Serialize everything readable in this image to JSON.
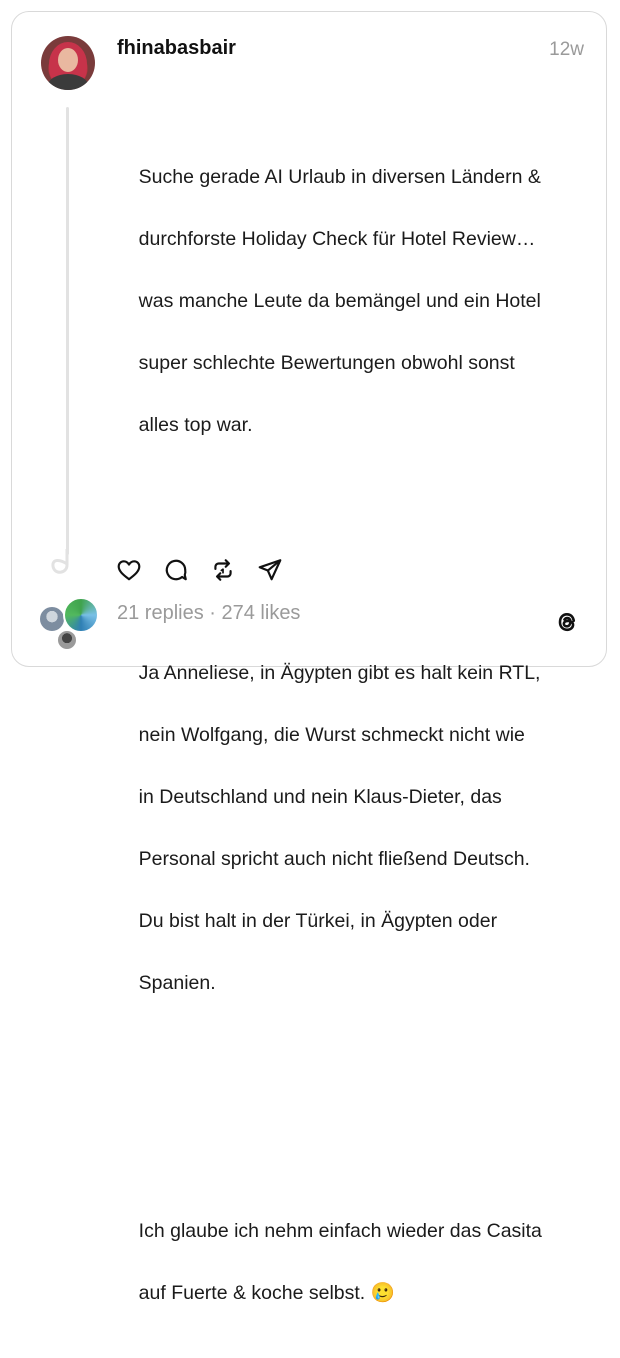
{
  "post": {
    "username": "fhinabasbair",
    "time": "12w",
    "paragraphs": [
      [
        "Suche gerade AI Urlaub in diversen Ländern &",
        "durchforste Holiday Check für Hotel Review…",
        "was manche Leute da bemängel und ein Hotel",
        "super schlechte Bewertungen obwohl sonst",
        "alles top war."
      ],
      [
        "Ja Anneliese, in Ägypten gibt es halt kein RTL,",
        "nein Wolfgang, die Wurst schmeckt nicht wie",
        "in Deutschland und nein Klaus-Dieter, das",
        "Personal spricht auch nicht fließend Deutsch.",
        "Du bist halt in der Türkei, in Ägypten oder",
        "Spanien."
      ],
      [
        "Ich glaube ich nehm einfach wieder das Casita",
        "auf Fuerte & koche selbst. 🥲"
      ]
    ]
  },
  "stats": {
    "replies": "21 replies",
    "separator": " · ",
    "likes": "274 likes"
  },
  "icons": {
    "like": "heart-icon",
    "comment": "comment-icon",
    "repost": "repost-icon",
    "share": "share-icon",
    "brand": "threads-logo-icon"
  },
  "colors": {
    "text": "#1b1b1b",
    "muted": "#9a9a9a",
    "border": "#d9d9d9",
    "thread_line": "#e2e2e2"
  }
}
